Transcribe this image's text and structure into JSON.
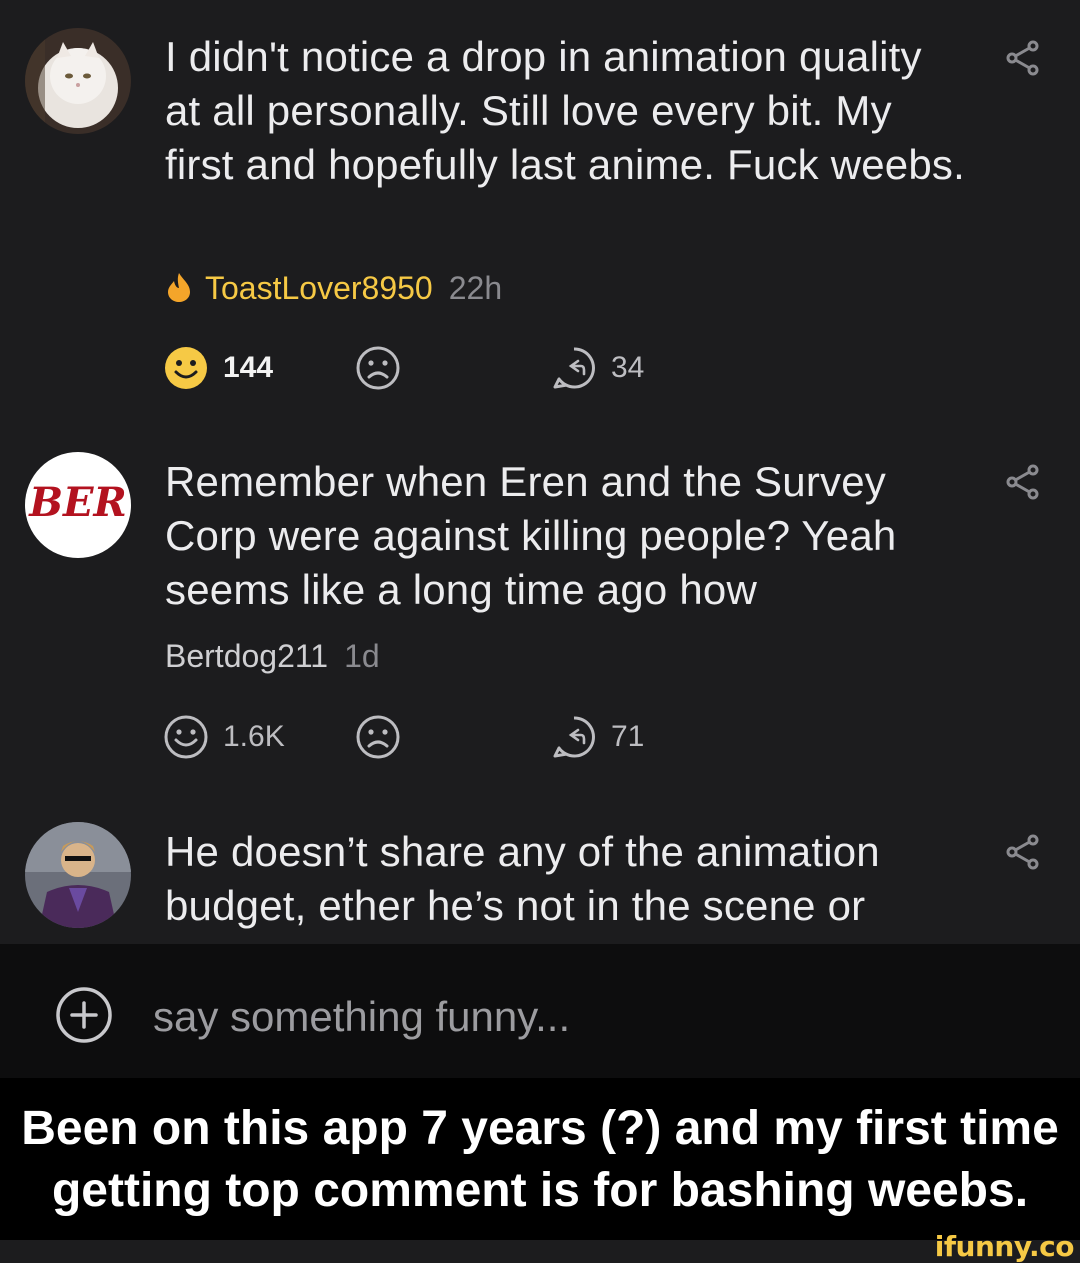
{
  "comments": [
    {
      "text": "I didn't notice a drop in animation quality at all personally. Still love every bit. My first and hopefully last anime. Fuck weebs.",
      "username": "ToastLover8950",
      "time": "22h",
      "smile_count": "144",
      "reply_count": "34",
      "avatar_icon": "white-cat-avatar",
      "highlighted": true
    },
    {
      "text": "Remember when Eren and the Survey Corp were against killing people? Yeah seems like a long time ago how",
      "username": "Bertdog211",
      "time": "1d",
      "smile_count": "1.6K",
      "reply_count": "71",
      "avatar_icon": "ber-logo-avatar",
      "avatar_text": "BER"
    },
    {
      "text": "He doesn’t share any of the animation budget, ether he’s not in the scene or",
      "avatar_icon": "suited-man-avatar"
    }
  ],
  "composer": {
    "placeholder": "say something funny...",
    "icon": "plus-circle-icon"
  },
  "caption": {
    "line1": "Been on this app 7 years (?) and my first time",
    "line2": "getting top comment is for bashing weebs."
  },
  "watermark": "ifunny.co",
  "colors": {
    "background": "#1c1c1e",
    "accent_yellow": "#f6c945",
    "flame_orange": "#f4a52a",
    "muted": "#8a8a8f"
  }
}
